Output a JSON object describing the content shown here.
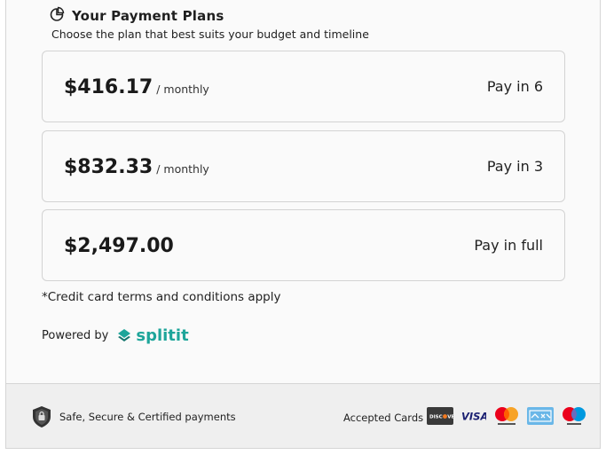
{
  "header": {
    "title": "Your Payment Plans",
    "subtitle": "Choose the plan that best suits your budget and timeline",
    "icon": "pie-chart-icon"
  },
  "plans": [
    {
      "amount": "$416.17",
      "period": "/ monthly",
      "label": "Pay in 6"
    },
    {
      "amount": "$832.33",
      "period": "/ monthly",
      "label": "Pay in 3"
    },
    {
      "amount": "$2,497.00",
      "period": "",
      "label": "Pay in full"
    }
  ],
  "terms": "*Credit card terms and conditions apply",
  "powered": {
    "label": "Powered by",
    "brand": "splitit"
  },
  "footer": {
    "secure_text": "Safe, Secure & Certified payments",
    "accepted_label": "Accepted Cards",
    "cards": [
      "discover-card-icon",
      "visa-card-icon",
      "mastercard-card-icon",
      "amex-card-icon",
      "maestro-card-icon"
    ]
  },
  "colors": {
    "brand": "#1ea59a",
    "border": "#d3d3d3",
    "footer_bg": "#efefef"
  }
}
